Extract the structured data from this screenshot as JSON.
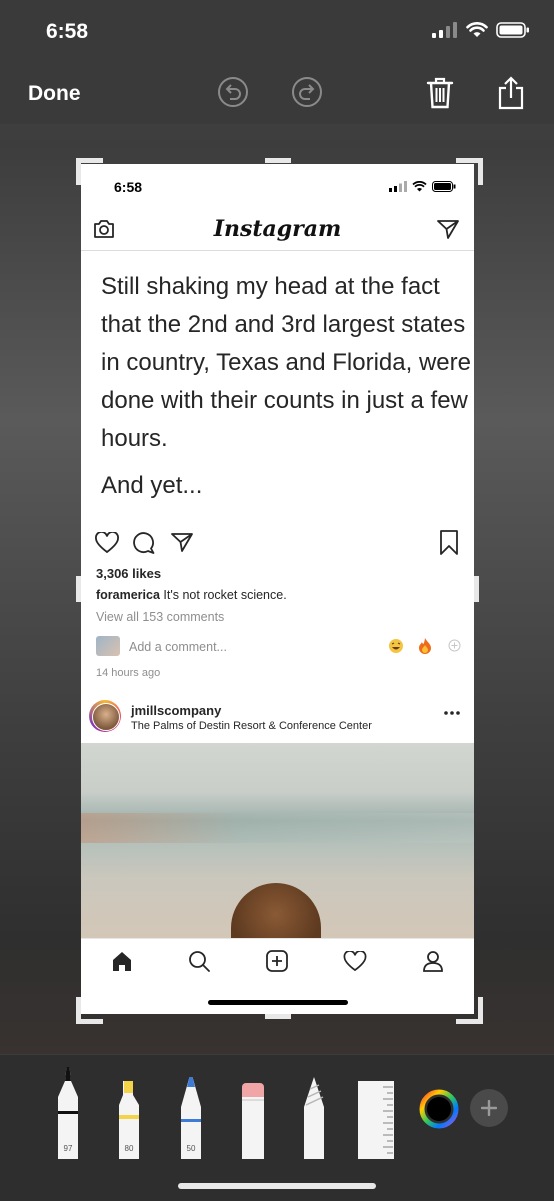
{
  "status_bar": {
    "time": "6:58"
  },
  "markup_toolbar": {
    "done_label": "Done"
  },
  "screenshot": {
    "status_time": "6:58",
    "app_title": "Instagram",
    "post1": {
      "text": "Still shaking my head at the fact that the 2nd and 3rd largest states in country, Texas and Florida, were done with their counts in just a few hours.",
      "text2": "And yet...",
      "likes": "3,306 likes",
      "caption_user": "foramerica",
      "caption_text": " It's not rocket science.",
      "view_comments": "View all 153 comments",
      "comment_placeholder": "Add a comment...",
      "time_ago": "14 hours ago"
    },
    "post2": {
      "username": "jmillscompany",
      "location": "The Palms of Destin Resort & Conference Center"
    }
  },
  "tools": {
    "pen_width": "97",
    "highlighter_width": "80",
    "pencil_width": "50"
  },
  "colors": {
    "accent_white": "#ffffff",
    "highlighter": "#f3d34a",
    "pencil": "#3d7bd6"
  }
}
